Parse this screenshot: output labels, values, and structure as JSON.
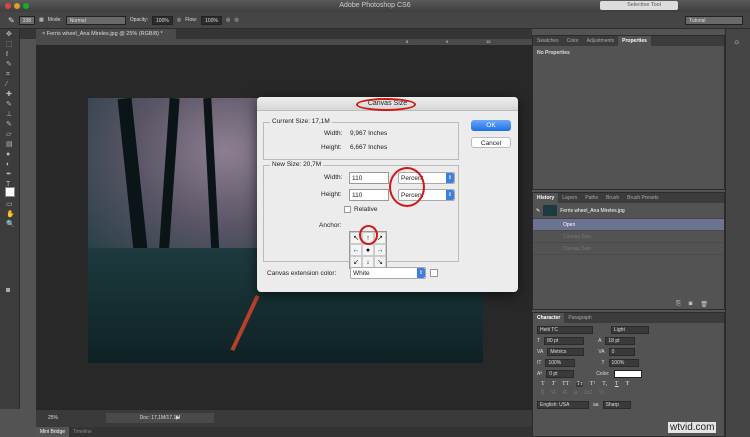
{
  "app": {
    "title": "Adobe Photoshop CS6",
    "selective_tool": "Selective Tool",
    "workspace": "Tutorial"
  },
  "options": {
    "brush_size": "338",
    "mode_label": "Mode:",
    "mode": "Normal",
    "opacity_label": "Opacity:",
    "opacity": "100%",
    "flow_label": "Flow:",
    "flow": "100%"
  },
  "document": {
    "tab": "Ferris wheel_Ana Mireles.jpg @ 25% (RGB/8) *",
    "zoom": "25%",
    "doc_info": "Doc: 17,1M/17,1M",
    "ruler_ticks": [
      "8",
      "9",
      "10"
    ]
  },
  "bottom_tabs": [
    "Mini Bridge",
    "Timeline"
  ],
  "properties_panel": {
    "tabs": [
      "Swatches",
      "Color",
      "Adjustments",
      "Properties"
    ],
    "active": "Properties",
    "content": "No Properties"
  },
  "history_panel": {
    "tabs": [
      "History",
      "Layers",
      "Paths",
      "Brush",
      "Brush Presets"
    ],
    "snapshot": "Ferris wheel_Ana Mireles.jpg",
    "states": [
      "Open",
      "Canvas Size",
      "Canvas Size"
    ]
  },
  "character_panel": {
    "tabs": [
      "Character",
      "Paragraph"
    ],
    "font": "Heiti TC",
    "style": "Light",
    "size": "80 pt",
    "leading": "18 pt",
    "kerning": "Metrics",
    "tracking": "0",
    "vscale": "100%",
    "hscale": "100%",
    "baseline": "0 pt",
    "color_label": "Color:",
    "color": "#ffffff",
    "language": "English: USA",
    "antialias": "Sharp",
    "type_buttons": [
      "T",
      "T",
      "TT",
      "Tт",
      "T¹",
      "T₁",
      "T",
      "Ŧ"
    ]
  },
  "dialog": {
    "title": "Canvas Size",
    "current_size": "Current Size: 17,1M",
    "width_label": "Width:",
    "width_value": "9,967 Inches",
    "height_label": "Height:",
    "height_value": "6,667 Inches",
    "new_size": "New Size: 20,7M",
    "new_width": "110",
    "new_height": "110",
    "unit": "Percent",
    "relative": "Relative",
    "anchor_label": "Anchor:",
    "ext_label": "Canvas extension color:",
    "ext_color": "White",
    "ok": "OK",
    "cancel": "Cancel",
    "anchor_arrows": [
      "↖",
      "↑",
      "↗",
      "←",
      "●",
      "→",
      "↙",
      "↓",
      "↘"
    ]
  },
  "watermark": "wtvid.com"
}
